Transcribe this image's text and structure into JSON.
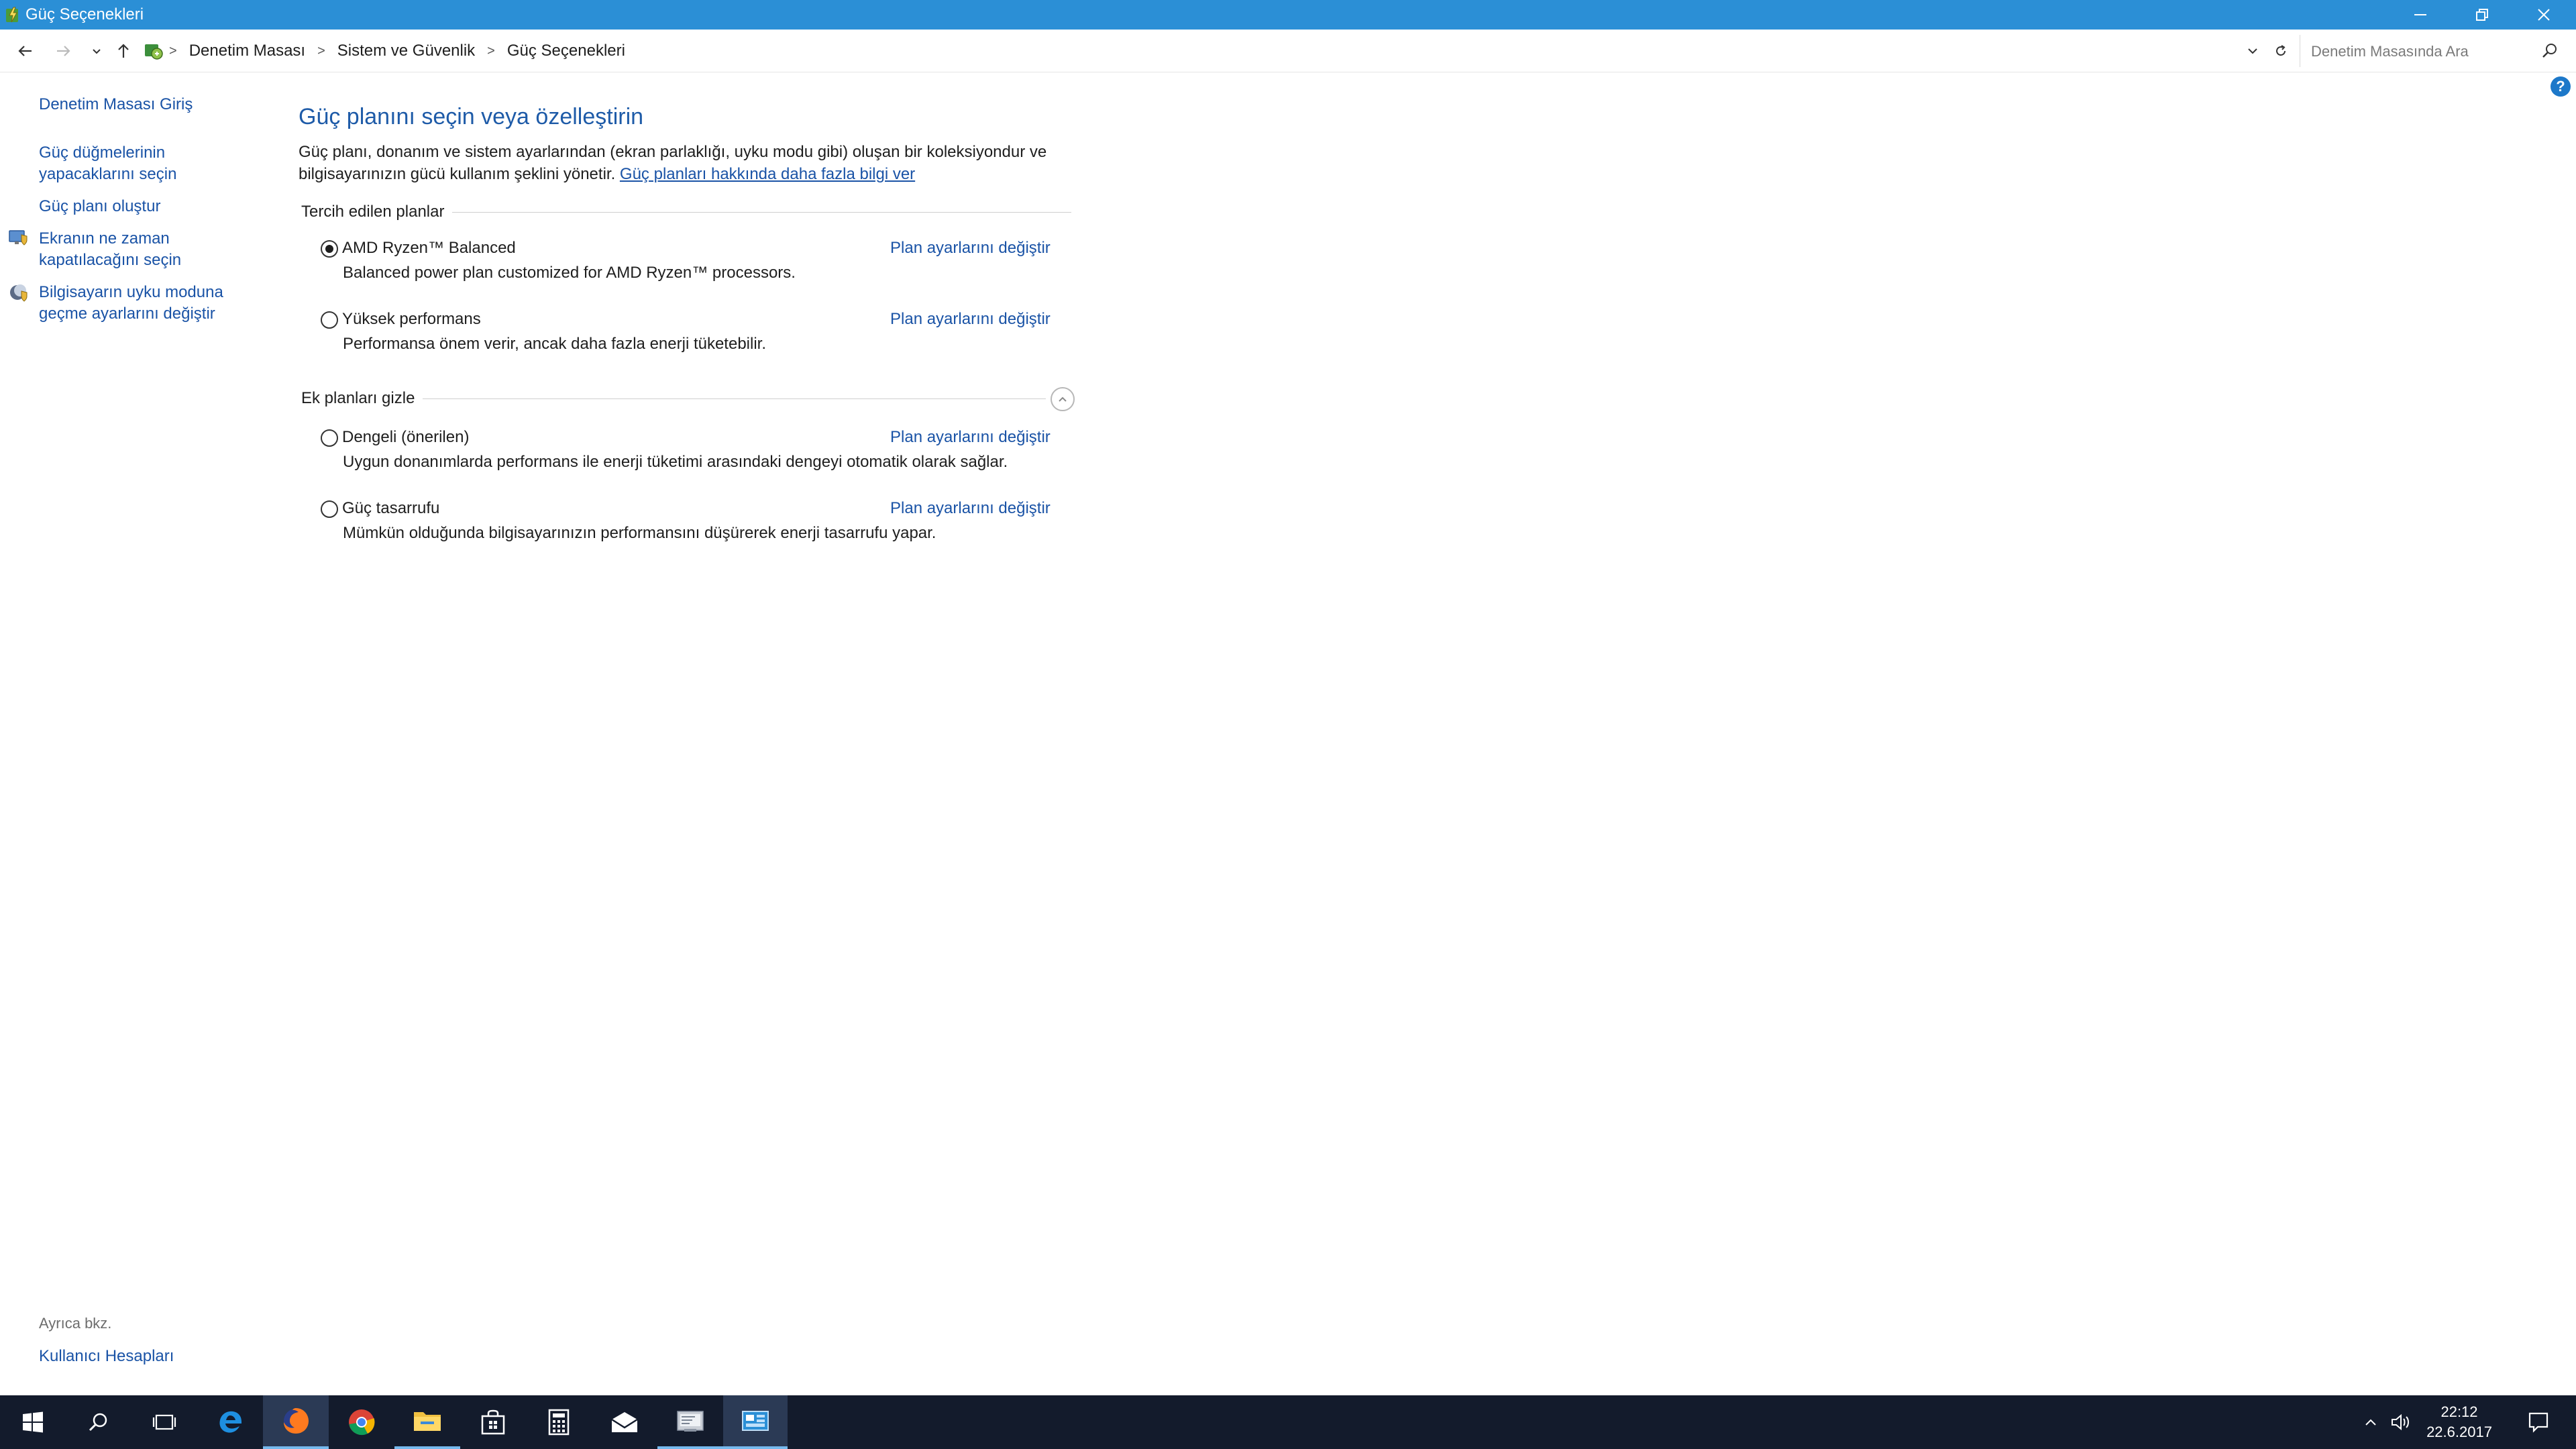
{
  "window": {
    "title": "Güç Seçenekleri"
  },
  "address": {
    "breadcrumbs": [
      "Denetim Masası",
      "Sistem ve Güvenlik",
      "Güç Seçenekleri"
    ],
    "search_placeholder": "Denetim Masasında Ara"
  },
  "leftnav": {
    "home": "Denetim Masası Giriş",
    "power_buttons": [
      "Güç düğmelerinin",
      "yapacaklarını seçin"
    ],
    "create_plan": "Güç planı oluştur",
    "display_off": [
      "Ekranın ne zaman",
      "kapatılacağını seçin"
    ],
    "sleep": [
      "Bilgisayarın uyku moduna",
      "geçme ayarlarını değiştir"
    ],
    "see_also": "Ayrıca bkz.",
    "user_accounts": "Kullanıcı Hesapları"
  },
  "main": {
    "heading": "Güç planını seçin veya özelleştirin",
    "description": "Güç planı, donanım ve sistem ayarlarından (ekran parlaklığı, uyku modu gibi) oluşan bir koleksiyondur ve bilgisayarınızın gücü kullanım şeklini yönetir.",
    "learn_more": "Güç planları hakkında daha fazla bilgi ver",
    "preferred_label": "Tercih edilen planlar",
    "extra_label": "Ek planları gizle",
    "change_link": "Plan ayarlarını değiştir",
    "preferred_plans": [
      {
        "name": "AMD Ryzen™ Balanced",
        "desc": "Balanced power plan customized for AMD Ryzen™ processors.",
        "selected": true
      },
      {
        "name": "Yüksek performans",
        "desc": "Performansa önem verir, ancak daha fazla enerji tüketebilir.",
        "selected": false
      }
    ],
    "extra_plans": [
      {
        "name": "Dengeli (önerilen)",
        "desc": "Uygun donanımlarda performans ile enerji tüketimi arasındaki dengeyi otomatik olarak sağlar.",
        "selected": false
      },
      {
        "name": "Güç tasarrufu",
        "desc": "Mümkün olduğunda bilgisayarınızın performansını düşürerek enerji tasarrufu yapar.",
        "selected": false
      }
    ]
  },
  "taskbar": {
    "time": "22:12",
    "date": "22.6.2017"
  },
  "colors": {
    "titlebar": "#2b8fd6",
    "link": "#1a53a6",
    "heading": "#1e5ba8",
    "taskbar": "#131b2c"
  }
}
